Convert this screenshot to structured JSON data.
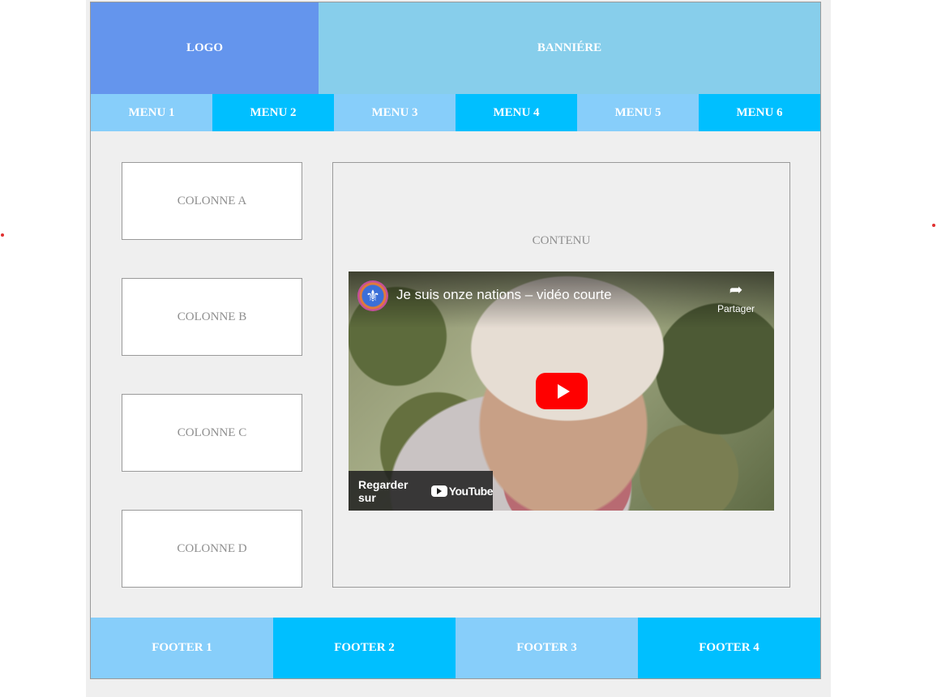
{
  "header": {
    "logo": "LOGO",
    "banner": "BANNIÉRE"
  },
  "menu": [
    {
      "label": "MENU 1"
    },
    {
      "label": "MENU 2"
    },
    {
      "label": "MENU 3"
    },
    {
      "label": "MENU 4"
    },
    {
      "label": "MENU 5"
    },
    {
      "label": "MENU 6"
    }
  ],
  "columns": [
    {
      "label": "COLONNE A"
    },
    {
      "label": "COLONNE B"
    },
    {
      "label": "COLONNE C"
    },
    {
      "label": "COLONNE D"
    }
  ],
  "content": {
    "title": "CONTENU",
    "video": {
      "title": "Je suis onze nations – vidéo courte",
      "share_label": "Partager",
      "watch_label": "Regarder sur",
      "platform": "YouTube",
      "icons": {
        "channel": "fleur-de-lis-icon",
        "share": "share-arrow-icon",
        "play": "play-icon"
      }
    }
  },
  "footer": [
    {
      "label": "FOOTER 1"
    },
    {
      "label": "FOOTER 2"
    },
    {
      "label": "FOOTER 3"
    },
    {
      "label": "FOOTER 4"
    }
  ],
  "colors": {
    "logo": "#6495ed",
    "banner": "#87ceeb",
    "nav_light": "#87cefa",
    "nav_dark": "#00bfff",
    "youtube_red": "#ff0000"
  }
}
